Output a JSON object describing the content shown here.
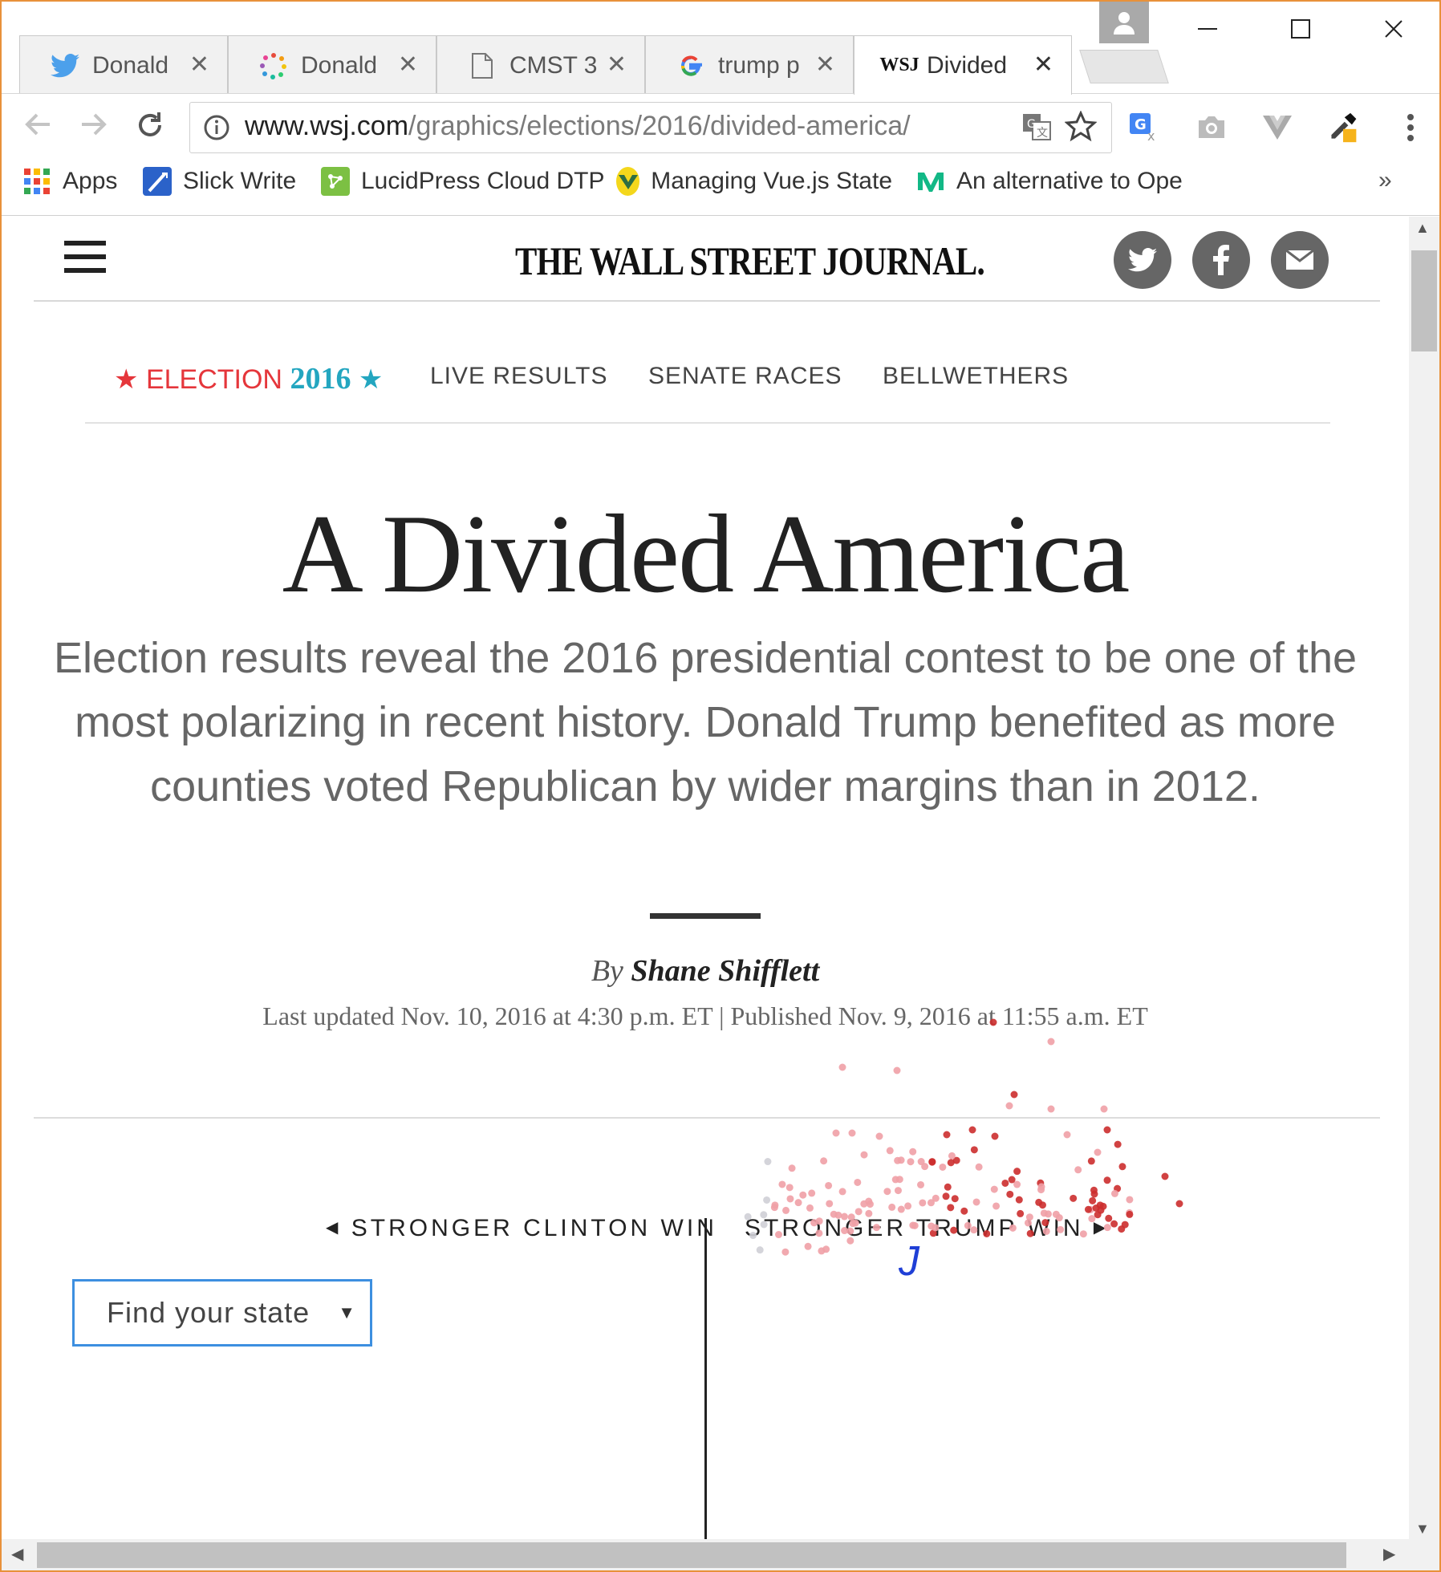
{
  "tabs": [
    {
      "title": "Donald",
      "icon": "twitter-icon"
    },
    {
      "title": "Donald",
      "icon": "dots-icon"
    },
    {
      "title": "CMST 3",
      "icon": "document-icon"
    },
    {
      "title": "trump p",
      "icon": "google-icon"
    },
    {
      "title": "Divided",
      "icon": "wsj-icon",
      "favicon_text": "WSJ"
    }
  ],
  "address": {
    "domain": "www.wsj.com",
    "path": "/graphics/elections/2016/divided-america/"
  },
  "bookmarks": [
    {
      "label": "Apps",
      "icon": "apps-grid-icon"
    },
    {
      "label": "Slick Write",
      "icon": "slick-write-icon"
    },
    {
      "label": "LucidPress Cloud DTP",
      "icon": "lucidpress-icon"
    },
    {
      "label": "Managing Vue.js State",
      "icon": "vue-icon"
    },
    {
      "label": "An alternative to Ope",
      "icon": "medium-icon"
    }
  ],
  "bookmarks_overflow": "»",
  "site": {
    "masthead": "THE WALL STREET JOURNAL."
  },
  "subnav": {
    "election_word": "ELECTION",
    "election_year": "2016",
    "links": [
      "LIVE RESULTS",
      "SENATE RACES",
      "BELLWETHERS"
    ]
  },
  "article": {
    "headline": "A Divided America",
    "dek": "Election results reveal the 2016 presidential contest to be one of the most polarizing in recent history. Donald Trump benefited as more counties voted Republican by wider margins than in 2012.",
    "byline_prefix": "By",
    "author": "Shane Shifflett",
    "dateline": "Last updated Nov. 10, 2016 at 4:30 p.m. ET | Published Nov. 9, 2016 at 11:55 a.m. ET"
  },
  "graphic": {
    "left_label": "STRONGER CLINTON WIN",
    "right_label": "STRONGER TRUMP WIN",
    "state_select": "Find your state",
    "handwritten_mark": "J",
    "colors": {
      "trump_strong": "#cc2d2d",
      "trump_light": "#f0a0a6",
      "neutral": "#cfcfd6"
    }
  },
  "colors": {
    "election_red": "#e5363b",
    "election_teal": "#23a6c0",
    "select_border": "#3d8fe0",
    "window_border": "#e8913a"
  }
}
